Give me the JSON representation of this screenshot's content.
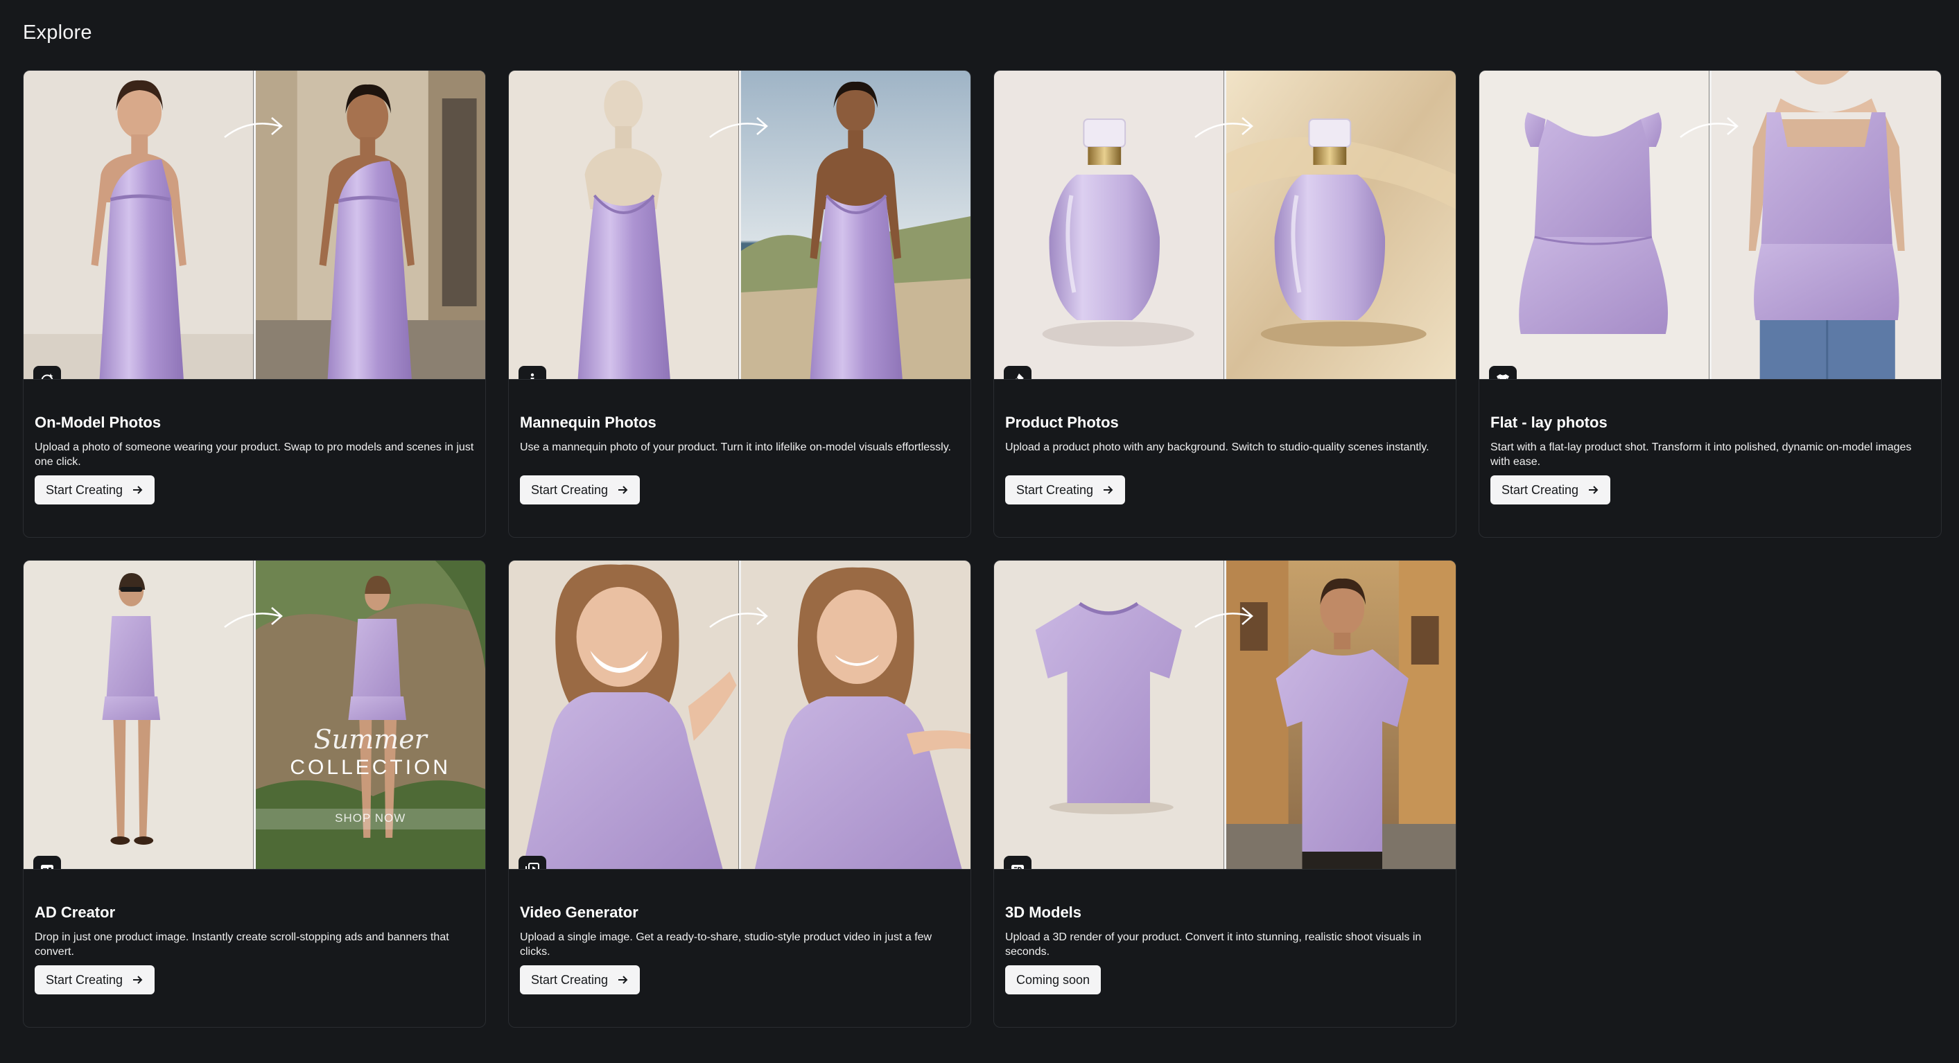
{
  "page": {
    "title": "Explore"
  },
  "colors": {
    "background": "#16181b",
    "button": "#f4f4f5",
    "lavender": "#b8a3d8"
  },
  "cards": [
    {
      "title": "On-Model Photos",
      "description": "Upload a photo of someone wearing your product. Swap to pro models and scenes in just one click.",
      "button": "Start Creating",
      "icon": "face-retouch-icon"
    },
    {
      "title": "Mannequin Photos",
      "description": "Use a mannequin photo of your product. Turn it into lifelike on-model visuals effortlessly.",
      "button": "Start Creating",
      "icon": "mannequin-icon"
    },
    {
      "title": "Product Photos",
      "description": "Upload a product photo with any background. Switch to studio-quality scenes instantly.",
      "button": "Start Creating",
      "icon": "brush-icon"
    },
    {
      "title": "Flat - lay photos",
      "description": "Start with a flat-lay product shot. Transform it into polished, dynamic on-model images with ease.",
      "button": "Start Creating",
      "icon": "tshirt-icon"
    },
    {
      "title": "AD Creator",
      "description": "Drop in just one product image. Instantly create scroll-stopping ads and banners that convert.",
      "button": "Start Creating",
      "icon": "ad-layout-icon",
      "ad_script": "Summer",
      "ad_headline": "COLLECTION",
      "ad_cta": "SHOP NOW"
    },
    {
      "title": "Video Generator",
      "description": "Upload a single image. Get a ready-to-share, studio-style product video in just a few clicks.",
      "button": "Start Creating",
      "icon": "video-stack-icon"
    },
    {
      "title": "3D Models",
      "description": "Upload a 3D render of your product. Convert it into stunning, realistic shoot visuals in seconds.",
      "button": "Coming soon",
      "icon": "cube-3d-icon"
    }
  ]
}
